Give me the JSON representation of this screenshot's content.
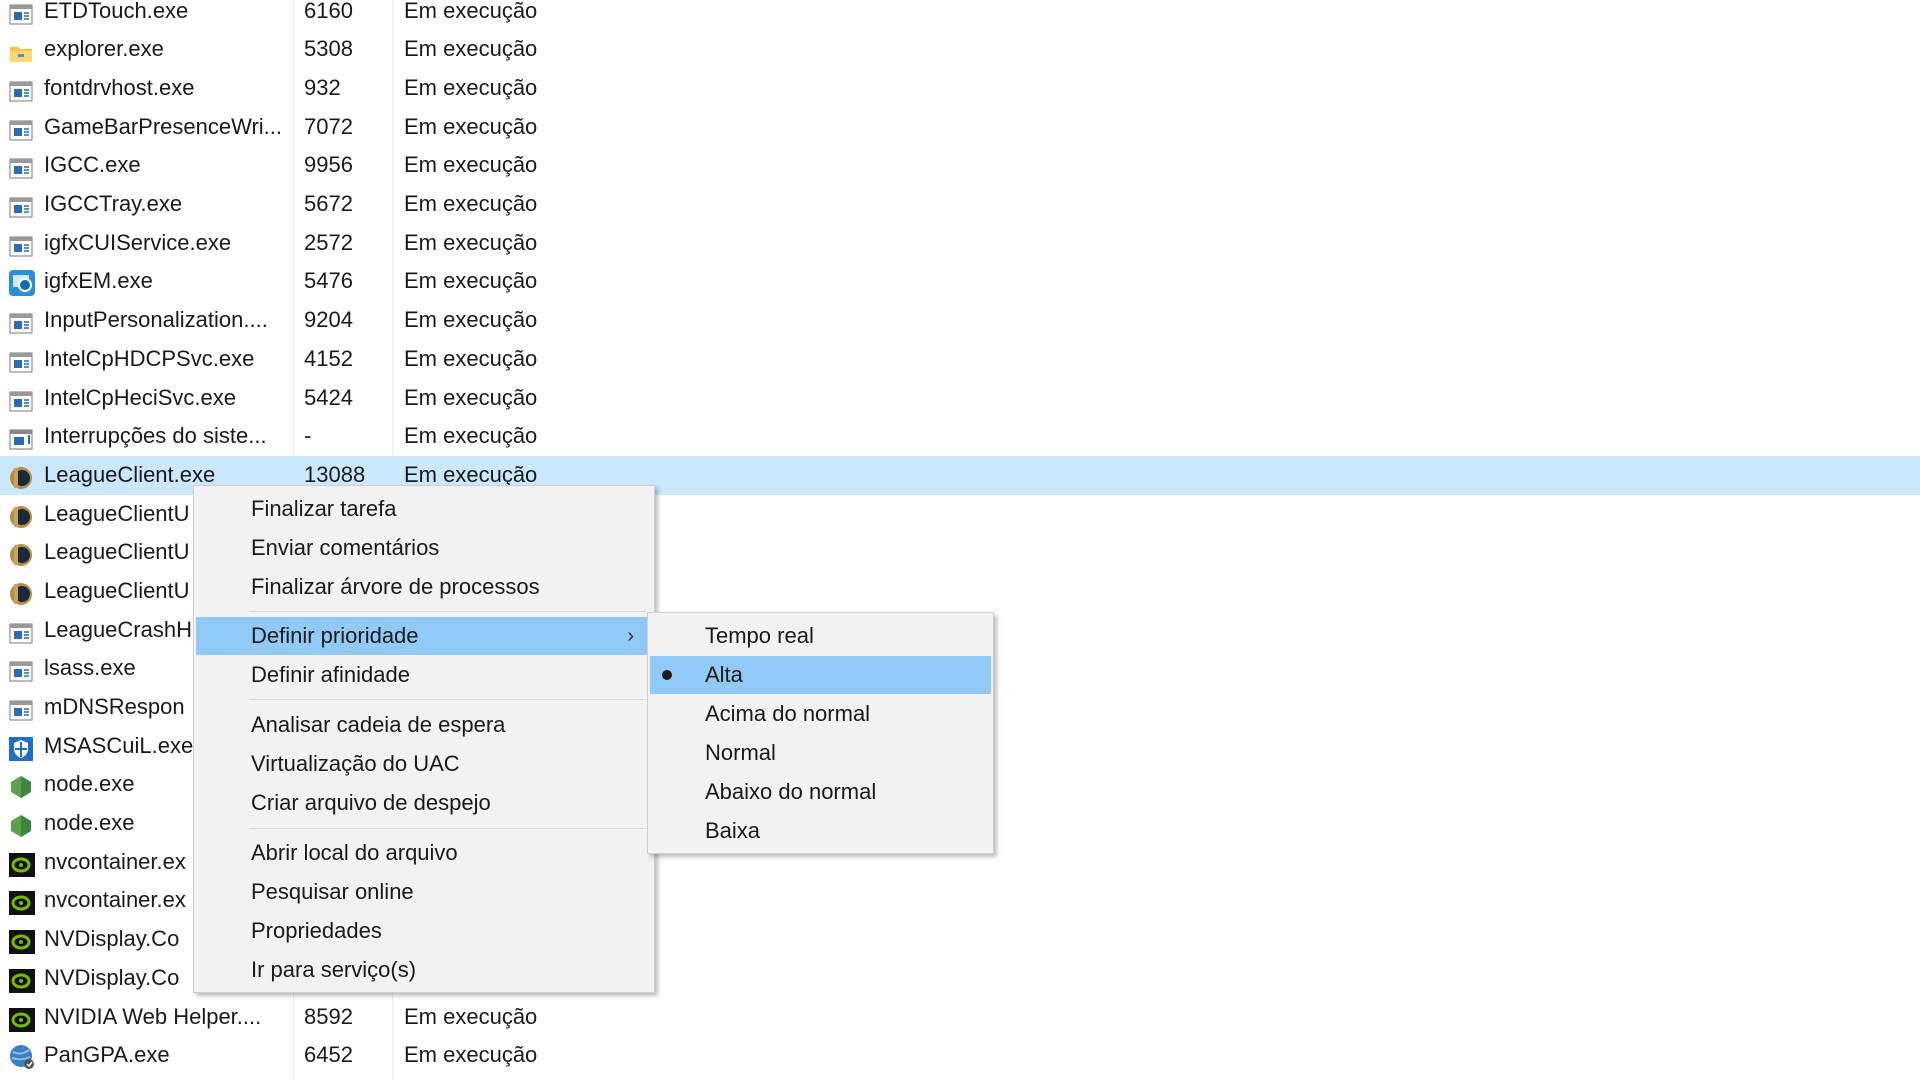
{
  "processes": [
    {
      "name": "ETDTouch.exe",
      "pid": "6160",
      "status": "Em execução",
      "icon": "app-window-icon"
    },
    {
      "name": "explorer.exe",
      "pid": "5308",
      "status": "Em execução",
      "icon": "folder-icon"
    },
    {
      "name": "fontdrvhost.exe",
      "pid": "932",
      "status": "Em execução",
      "icon": "app-window-icon"
    },
    {
      "name": "GameBarPresenceWri...",
      "pid": "7072",
      "status": "Em execução",
      "icon": "app-window-icon"
    },
    {
      "name": "IGCC.exe",
      "pid": "9956",
      "status": "Em execução",
      "icon": "app-window-icon"
    },
    {
      "name": "IGCCTray.exe",
      "pid": "5672",
      "status": "Em execução",
      "icon": "app-window-icon"
    },
    {
      "name": "igfxCUIService.exe",
      "pid": "2572",
      "status": "Em execução",
      "icon": "app-window-icon"
    },
    {
      "name": "igfxEM.exe",
      "pid": "5476",
      "status": "Em execução",
      "icon": "intel-graphics-icon"
    },
    {
      "name": "InputPersonalization....",
      "pid": "9204",
      "status": "Em execução",
      "icon": "app-window-icon"
    },
    {
      "name": "IntelCpHDCPSvc.exe",
      "pid": "4152",
      "status": "Em execução",
      "icon": "app-window-icon"
    },
    {
      "name": "IntelCpHeciSvc.exe",
      "pid": "5424",
      "status": "Em execução",
      "icon": "app-window-icon"
    },
    {
      "name": "Interrupções do siste...",
      "pid": "-",
      "status": "Em execução",
      "icon": "system-interrupts-icon"
    },
    {
      "name": "LeagueClient.exe",
      "pid": "13088",
      "status": "Em execução",
      "icon": "league-icon",
      "selected": true
    },
    {
      "name": "LeagueClientU",
      "icon": "league-icon"
    },
    {
      "name": "LeagueClientU",
      "icon": "league-icon"
    },
    {
      "name": "LeagueClientU",
      "icon": "league-icon"
    },
    {
      "name": "LeagueCrashH",
      "icon": "app-window-icon"
    },
    {
      "name": "lsass.exe",
      "icon": "app-window-icon"
    },
    {
      "name": "mDNSRespon",
      "icon": "app-window-icon"
    },
    {
      "name": "MSASCuiL.exe",
      "icon": "shield-icon"
    },
    {
      "name": "node.exe",
      "icon": "node-icon"
    },
    {
      "name": "node.exe",
      "icon": "node-icon"
    },
    {
      "name": "nvcontainer.ex",
      "icon": "nvidia-icon"
    },
    {
      "name": "nvcontainer.ex",
      "icon": "nvidia-icon"
    },
    {
      "name": "NVDisplay.Co",
      "icon": "nvidia-icon"
    },
    {
      "name": "NVDisplay.Co",
      "icon": "nvidia-icon"
    },
    {
      "name": "NVIDIA Web Helper....",
      "pid": "8592",
      "status": "Em execução",
      "icon": "nvidia-icon"
    },
    {
      "name": "PanGPA.exe",
      "pid": "6452",
      "status": "Em execução",
      "icon": "globe-icon"
    }
  ],
  "context_menu": {
    "items": [
      {
        "label": "Finalizar tarefa"
      },
      {
        "label": "Enviar comentários"
      },
      {
        "label": "Finalizar árvore de processos"
      },
      {
        "label": "Definir prioridade",
        "submenu": true,
        "highlighted": true
      },
      {
        "label": "Definir afinidade"
      },
      {
        "label": "Analisar cadeia de espera"
      },
      {
        "label": "Virtualização do UAC"
      },
      {
        "label": "Criar arquivo de despejo"
      },
      {
        "label": "Abrir local do arquivo"
      },
      {
        "label": "Pesquisar online"
      },
      {
        "label": "Propriedades"
      },
      {
        "label": "Ir para serviço(s)"
      }
    ]
  },
  "priority_submenu": {
    "items": [
      {
        "label": "Tempo real"
      },
      {
        "label": "Alta",
        "checked": true,
        "highlighted": true
      },
      {
        "label": "Acima do normal"
      },
      {
        "label": "Normal"
      },
      {
        "label": "Abaixo do normal"
      },
      {
        "label": "Baixa"
      }
    ]
  },
  "colors": {
    "selected_row": "#cce8ff",
    "menu_bg": "#f2f2f2",
    "menu_highlight": "#91c9f7"
  }
}
